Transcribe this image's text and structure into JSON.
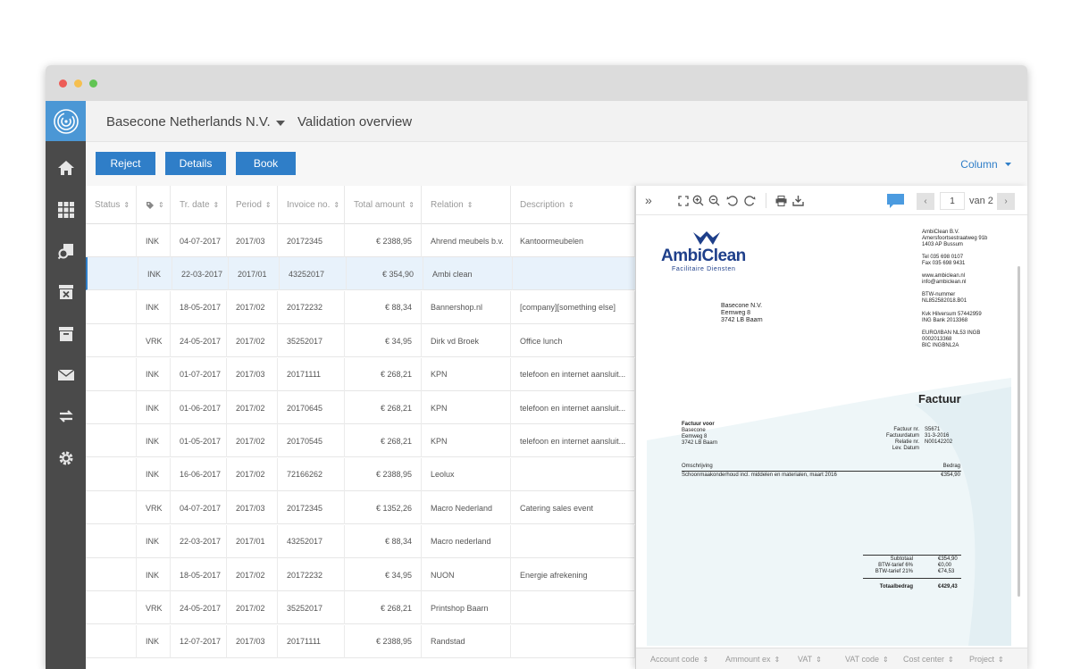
{
  "window": {
    "controls": [
      "close",
      "minimize",
      "zoom"
    ],
    "colors": {
      "close": "#ed5c57",
      "minimize": "#f5bf4f",
      "zoom": "#61c454"
    }
  },
  "sidebar": {
    "logo": "swirl-logo-icon",
    "items": [
      {
        "icon": "home-icon"
      },
      {
        "icon": "grid-icon"
      },
      {
        "icon": "document-search-icon"
      },
      {
        "icon": "rejected-box-icon"
      },
      {
        "icon": "archive-icon"
      },
      {
        "icon": "mail-icon"
      },
      {
        "icon": "transfer-icon"
      },
      {
        "icon": "settings-icon"
      }
    ]
  },
  "header": {
    "company": "Basecone Netherlands N.V.",
    "title": "Validation overview"
  },
  "toolbar": {
    "reject": "Reject",
    "details": "Details",
    "book": "Book",
    "column": "Column"
  },
  "table": {
    "headers": [
      "Status",
      "",
      "Tr. date",
      "Period",
      "Invoice no.",
      "Total amount",
      "Relation",
      "Description"
    ],
    "rows": [
      {
        "status": "",
        "type": "INK",
        "date": "04-07-2017",
        "period": "2017/03",
        "invoice": "20172345",
        "amount": "€ 2388,95",
        "relation": "Ahrend meubels b.v.",
        "description": "Kantoormeubelen"
      },
      {
        "status": "",
        "type": "INK",
        "date": "22-03-2017",
        "period": "2017/01",
        "invoice": "43252017",
        "amount": "€ 354,90",
        "relation": "Ambi clean",
        "description": ""
      },
      {
        "status": "",
        "type": "INK",
        "date": "18-05-2017",
        "period": "2017/02",
        "invoice": "20172232",
        "amount": "€ 88,34",
        "relation": "Bannershop.nl",
        "description": "[company][something else]"
      },
      {
        "status": "",
        "type": "VRK",
        "date": "24-05-2017",
        "period": "2017/02",
        "invoice": "35252017",
        "amount": "€ 34,95",
        "relation": "Dirk vd Broek",
        "description": "Office lunch"
      },
      {
        "status": "",
        "type": "INK",
        "date": "01-07-2017",
        "period": "2017/03",
        "invoice": "20171111",
        "amount": "€ 268,21",
        "relation": "KPN",
        "description": "telefoon en internet aansluit..."
      },
      {
        "status": "",
        "type": "INK",
        "date": "01-06-2017",
        "period": "2017/02",
        "invoice": "20170645",
        "amount": "€ 268,21",
        "relation": "KPN",
        "description": "telefoon en internet aansluit..."
      },
      {
        "status": "",
        "type": "INK",
        "date": "01-05-2017",
        "period": "2017/02",
        "invoice": "20170545",
        "amount": "€ 268,21",
        "relation": "KPN",
        "description": "telefoon en internet aansluit..."
      },
      {
        "status": "",
        "type": "INK",
        "date": "16-06-2017",
        "period": "2017/02",
        "invoice": "72166262",
        "amount": "€ 2388,95",
        "relation": "Leolux",
        "description": ""
      },
      {
        "status": "",
        "type": "VRK",
        "date": "04-07-2017",
        "period": "2017/03",
        "invoice": "20172345",
        "amount": "€ 1352,26",
        "relation": "Macro Nederland",
        "description": "Catering sales event"
      },
      {
        "status": "",
        "type": "INK",
        "date": "22-03-2017",
        "period": "2017/01",
        "invoice": "43252017",
        "amount": "€ 88,34",
        "relation": "Macro nederland",
        "description": ""
      },
      {
        "status": "",
        "type": "INK",
        "date": "18-05-2017",
        "period": "2017/02",
        "invoice": "20172232",
        "amount": "€ 34,95",
        "relation": "NUON",
        "description": "Energie afrekening"
      },
      {
        "status": "",
        "type": "VRK",
        "date": "24-05-2017",
        "period": "2017/02",
        "invoice": "35252017",
        "amount": "€ 268,21",
        "relation": "Printshop Baarn",
        "description": ""
      },
      {
        "status": "",
        "type": "INK",
        "date": "12-07-2017",
        "period": "2017/03",
        "invoice": "20171111",
        "amount": "€ 2388,95",
        "relation": "Randstad",
        "description": ""
      }
    ],
    "selected_row": 1
  },
  "viewer": {
    "page_current": "1",
    "page_total_label": "van 2",
    "footer_columns": [
      "Account code",
      "Ammount ex",
      "VAT",
      "VAT code",
      "Cost center",
      "Project"
    ],
    "invoice": {
      "logo_text": "AmbiClean",
      "logo_sub": "Facilitaire Diensten",
      "sender": [
        "AmbiClean B.V.",
        "Amersfoortsestraatweg 91b",
        "1403 AP Bussum"
      ],
      "phone": [
        "Tel   035 698 0107",
        "Fax   035 698 9431"
      ],
      "web": [
        "www.ambiclean.nl",
        "info@ambiclean.nl"
      ],
      "btw": [
        "BTW-nummer",
        "NL852582018.B01"
      ],
      "kvk": [
        "Kvk Hilversum 57442959",
        "ING Bank 2013368"
      ],
      "iban": [
        "EURO/IBAN NL53 INGB",
        "0002013368",
        "BIC INGBNL2A"
      ],
      "addressee": [
        "Basecone N.V.",
        "Eemweg 8",
        "3742 LB Baarn"
      ],
      "title": "Factuur",
      "factuur_voor_label": "Factuur voor",
      "factuur_voor": [
        "Basecone",
        "Eemweg 8",
        "3742 LB Baarn"
      ],
      "meta_labels": [
        "Factuur nr.",
        "Factuurdatum",
        "Relatie nr.",
        "Lev. Datum"
      ],
      "meta_values": [
        "S5671",
        "31-3-2016",
        "N00142202",
        ""
      ],
      "col_desc": "Omschrijving",
      "col_amount": "Bedrag",
      "line_desc": "Schoonmaakonderhoud incl. middelen en materialen, maart 2016",
      "line_amount": "€354,90",
      "totals_labels": [
        "Subtotaal",
        "BTW-tarief 6%",
        "BTW-tarief 21%"
      ],
      "totals_values": [
        "€354,90",
        "€0,00",
        "€74,53"
      ],
      "grand_label": "Totaalbedrag",
      "grand_value": "€429,43"
    }
  }
}
